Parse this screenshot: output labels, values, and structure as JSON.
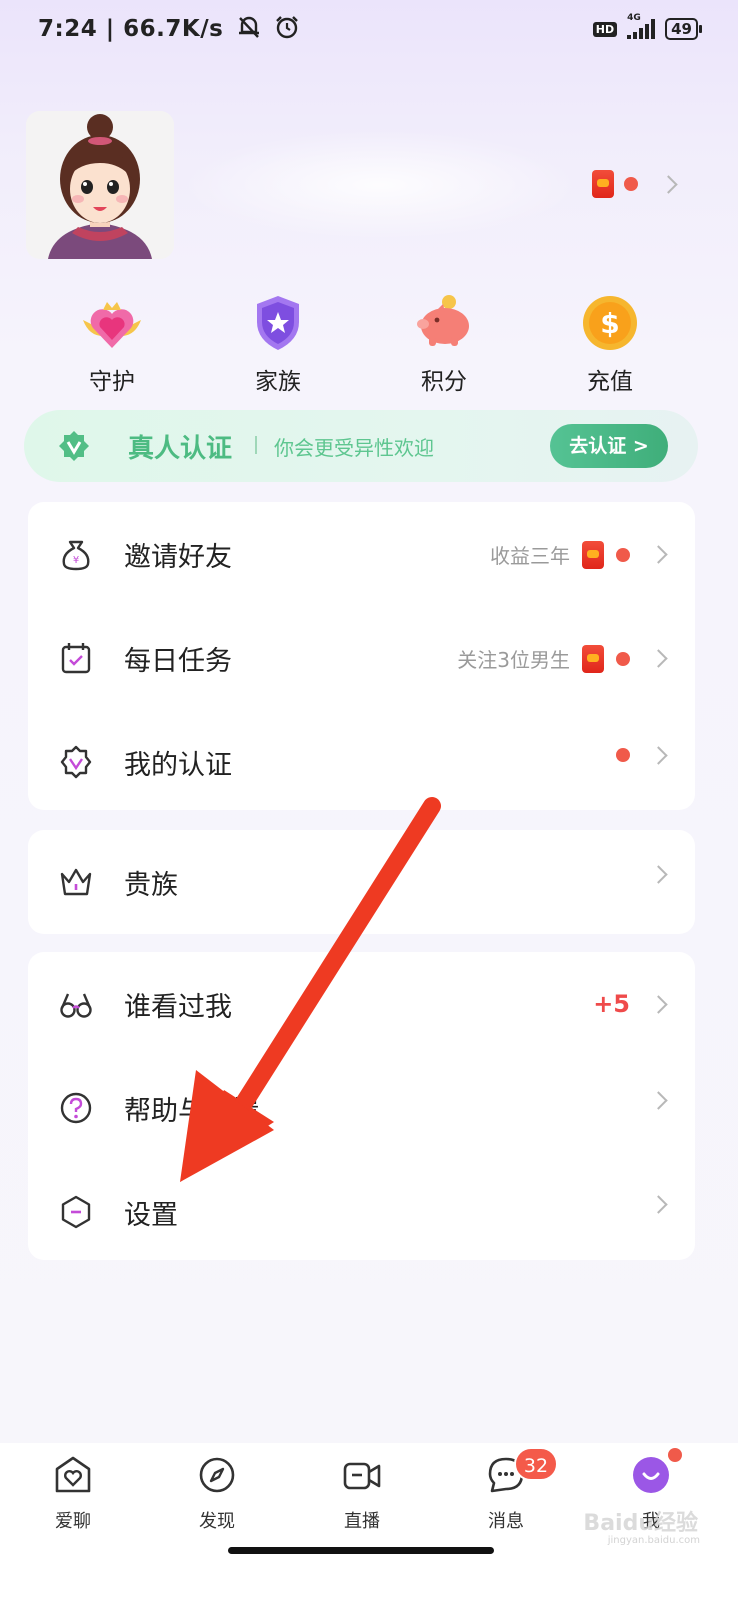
{
  "status_bar": {
    "time": "7:24",
    "speed": "66.7K/s",
    "hd": "HD",
    "network": "4G",
    "battery": "49"
  },
  "profile": {
    "colors": {
      "red_packet": "#e0261a",
      "dot": "#f05a4a"
    }
  },
  "quick_actions": [
    {
      "label": "守护",
      "icon": "heart-crown-icon"
    },
    {
      "label": "家族",
      "icon": "shield-star-icon"
    },
    {
      "label": "积分",
      "icon": "piggy-bank-icon"
    },
    {
      "label": "充值",
      "icon": "coin-icon"
    }
  ],
  "verify_banner": {
    "title": "真人认证",
    "subtitle": "你会更受异性欢迎",
    "button": "去认证 >"
  },
  "menu_group_1": [
    {
      "label": "邀请好友",
      "hint": "收益三年",
      "icon": "money-bag-icon"
    },
    {
      "label": "每日任务",
      "hint": "关注3位男生",
      "icon": "calendar-check-icon"
    },
    {
      "label": "我的认证",
      "icon": "badge-check-icon"
    }
  ],
  "menu_group_2": [
    {
      "label": "贵族",
      "icon": "crown-icon"
    }
  ],
  "menu_group_3": [
    {
      "label": "谁看过我",
      "count": "+5",
      "icon": "glasses-icon"
    },
    {
      "label": "帮助与反馈",
      "icon": "help-circle-icon"
    },
    {
      "label": "设置",
      "icon": "settings-hexagon-icon"
    }
  ],
  "tab_bar": {
    "tabs": [
      {
        "label": "爱聊",
        "icon": "home-heart-icon"
      },
      {
        "label": "发现",
        "icon": "compass-icon"
      },
      {
        "label": "直播",
        "icon": "video-camera-icon"
      },
      {
        "label": "消息",
        "icon": "chat-bubble-icon"
      },
      {
        "label": "我",
        "icon": "me-face-icon"
      }
    ],
    "message_badge": "32",
    "accent": "#9b57e6"
  },
  "watermark": {
    "brand": "Baidu经验",
    "url": "jingyan.baidu.com"
  }
}
